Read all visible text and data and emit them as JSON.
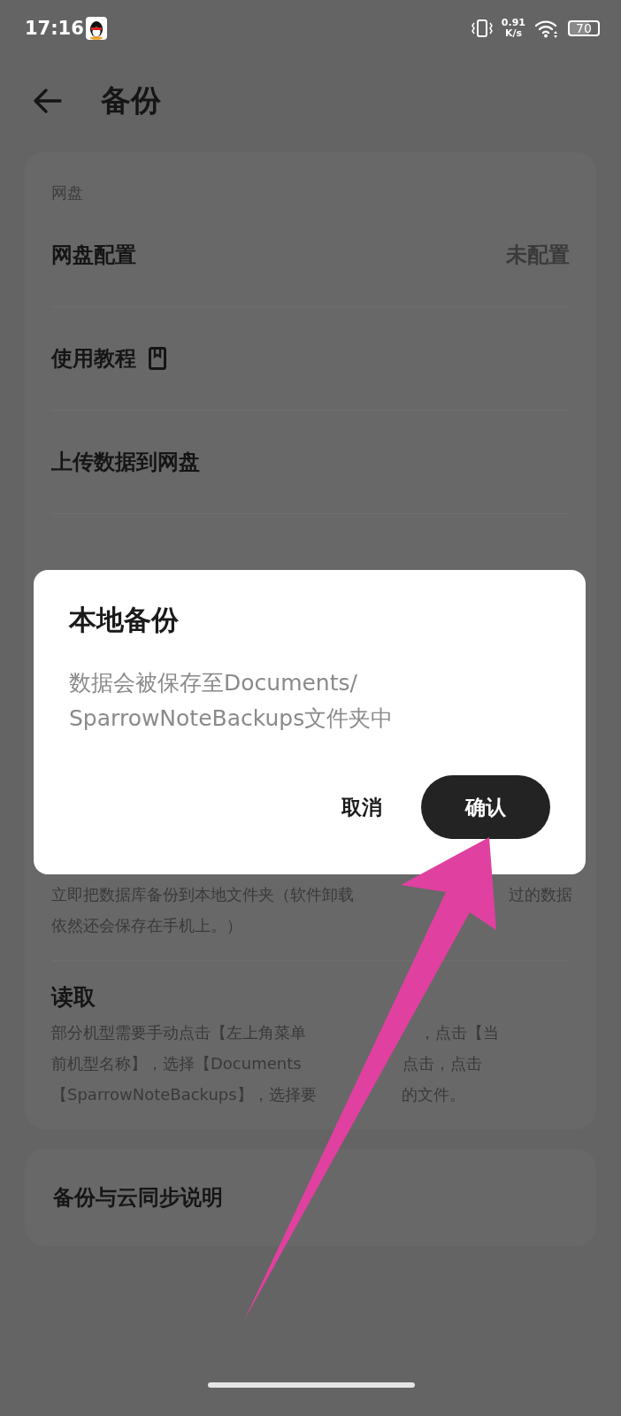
{
  "status_bar": {
    "time": "17:16",
    "speed_value": "0.91",
    "speed_unit": "K/s",
    "battery": "70"
  },
  "header": {
    "title": "备份"
  },
  "cloud_card": {
    "section": "网盘",
    "rows": [
      {
        "kind": "value",
        "label": "网盘配置",
        "value": "未配置"
      },
      {
        "kind": "guide",
        "label": "使用教程"
      },
      {
        "kind": "plain",
        "label": "上传数据到网盘"
      }
    ],
    "local_items": [
      {
        "kind": "note",
        "lines": [
          [
            "立即把数据库备份到本地文件夹（软件卸载",
            "过的数据"
          ],
          [
            "依然还会保存在手机上。）"
          ]
        ]
      },
      {
        "kind": "titled",
        "title": "读取",
        "lines": [
          [
            "部分机型需要手动点击【左上角菜单",
            "，点击【当"
          ],
          [
            "前机型名称】，选择【Documents",
            "点击，点击"
          ],
          [
            "【SparrowNoteBackups】，选择要",
            "的文件。"
          ]
        ]
      }
    ]
  },
  "help_card": {
    "label": "备份与云同步说明"
  },
  "dialog": {
    "title": "本地备份",
    "message_lines": [
      "数据会被保存至Documents/",
      "SparrowNoteBackups文件夹中"
    ],
    "buttons": [
      {
        "kind": "text",
        "label": "取消"
      },
      {
        "kind": "primary",
        "label": "确认"
      }
    ]
  }
}
